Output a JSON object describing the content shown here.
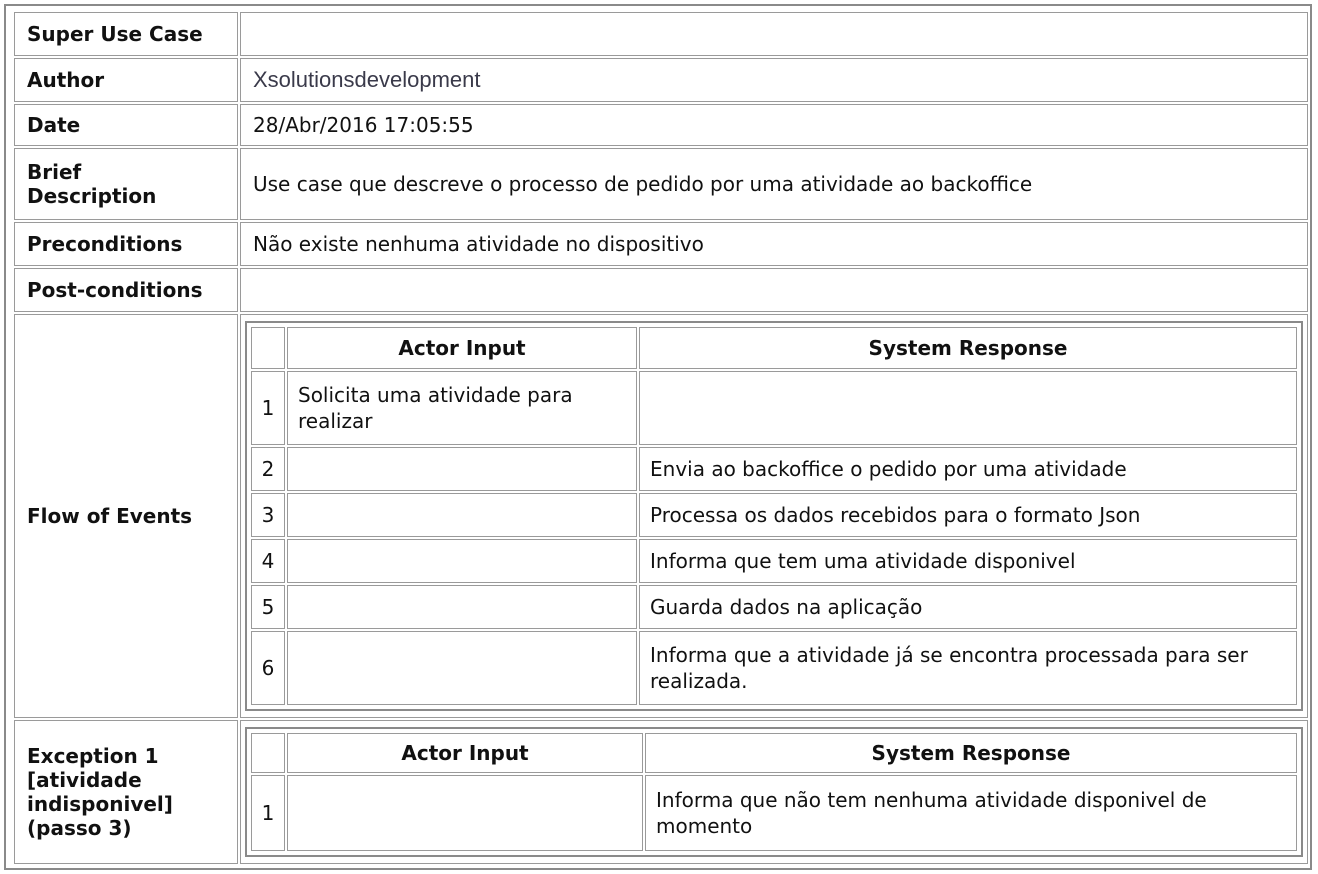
{
  "rows": {
    "super_use_case": {
      "label": "Super Use Case",
      "value": ""
    },
    "author": {
      "label": "Author",
      "value": "Xsolutionsdevelopment"
    },
    "date": {
      "label": "Date",
      "value": "28/Abr/2016 17:05:55"
    },
    "brief": {
      "label": "Brief\nDescription",
      "value": "Use case que descreve o processo de pedido por uma atividade ao backoffice"
    },
    "pre": {
      "label": "Preconditions",
      "value": "Não existe nenhuma atividade no dispositivo"
    },
    "post": {
      "label": "Post-conditions",
      "value": ""
    },
    "flow": {
      "label": "Flow of Events"
    },
    "exception": {
      "label": "Exception 1\n[atividade\nindisponivel]\n(passo 3)"
    }
  },
  "flow_table": {
    "headers": [
      "",
      "Actor Input",
      "System Response"
    ],
    "rows": [
      {
        "n": "1",
        "actor": "Solicita uma atividade para realizar",
        "system": ""
      },
      {
        "n": "2",
        "actor": "",
        "system": "Envia ao backoffice o pedido por uma atividade"
      },
      {
        "n": "3",
        "actor": "",
        "system": "Processa os dados recebidos para o formato Json"
      },
      {
        "n": "4",
        "actor": "",
        "system": "Informa que tem uma atividade disponivel"
      },
      {
        "n": "5",
        "actor": "",
        "system": "Guarda dados na aplicação"
      },
      {
        "n": "6",
        "actor": "",
        "system": "Informa que a atividade já se encontra processada para ser realizada."
      }
    ]
  },
  "exception_table": {
    "headers": [
      "",
      "Actor Input",
      "System Response"
    ],
    "rows": [
      {
        "n": "1",
        "actor": "",
        "system": "Informa que não tem nenhuma atividade disponivel de momento"
      }
    ]
  }
}
